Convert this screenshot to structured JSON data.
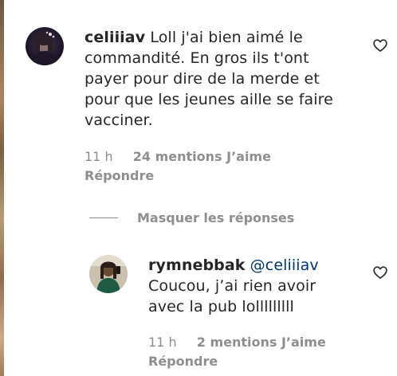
{
  "comments": [
    {
      "username": "celiiiav",
      "text": "Loll j'ai bien aimé le commandité. En gros ils t'ont payer pour dire de la merde et pour que les jeunes aille se faire vacciner.",
      "time": "11 h",
      "likes": "24 mentions J’aime",
      "reply": "Répondre",
      "like_icon": "heart-outline-icon"
    }
  ],
  "replies_toggle": {
    "label": "Masquer les réponses"
  },
  "replies": [
    {
      "username": "rymnebbak",
      "mention": "@celiiiav",
      "text": "Coucou, j’ai rien avoir avec la pub lolllllllll",
      "time": "11 h",
      "likes": "2 mentions J’aime",
      "reply": "Répondre",
      "like_icon": "heart-outline-icon"
    }
  ]
}
